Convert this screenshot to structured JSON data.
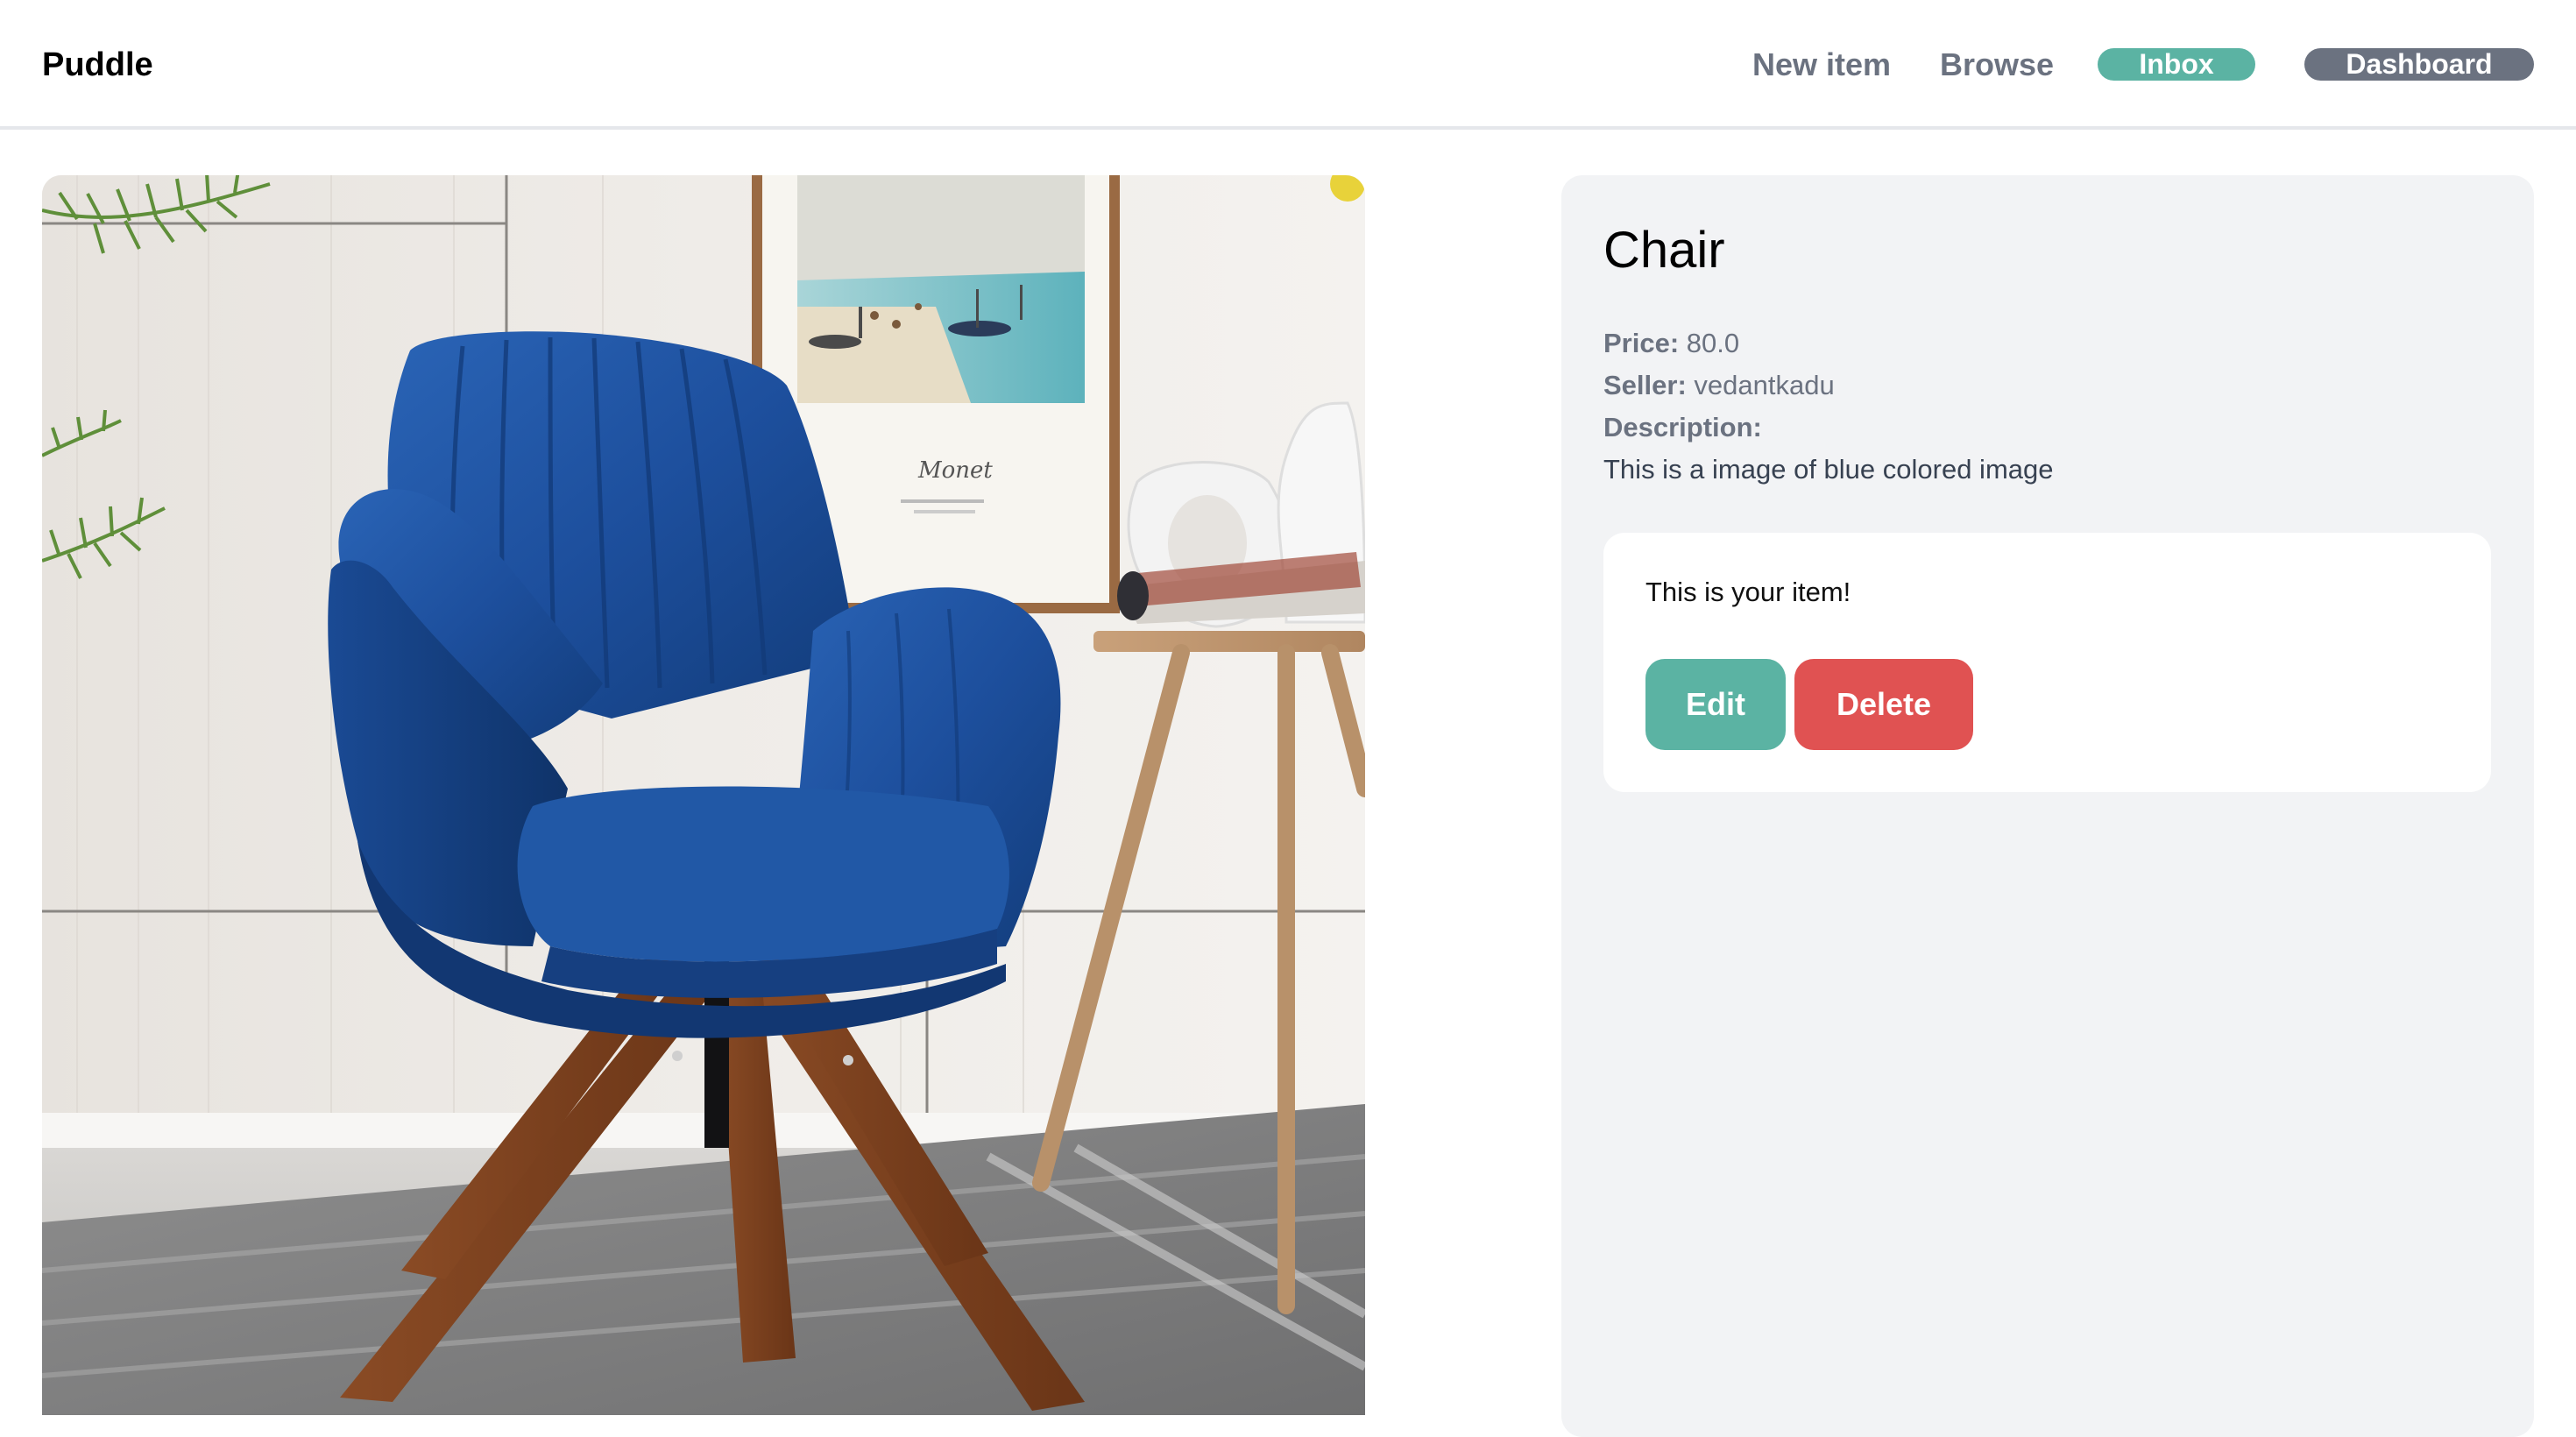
{
  "navbar": {
    "brand": "Puddle",
    "new_item": "New item",
    "browse": "Browse",
    "inbox": "Inbox",
    "dashboard": "Dashboard"
  },
  "item": {
    "image_alt": "Blue velvet swivel armchair with wooden legs",
    "name": "Chair",
    "price_label": "Price:",
    "price": "80.0",
    "seller_label": "Seller:",
    "seller": "vedantkadu",
    "description_label": "Description:",
    "description": "This is a image of blue colored image"
  },
  "owner_actions": {
    "note": "This is your item!",
    "edit_label": "Edit",
    "delete_label": "Delete"
  },
  "colors": {
    "accent_teal": "#5bb3a3",
    "danger_red": "#e05252",
    "muted_gray": "#6b7280",
    "panel_bg": "#f2f3f5"
  }
}
